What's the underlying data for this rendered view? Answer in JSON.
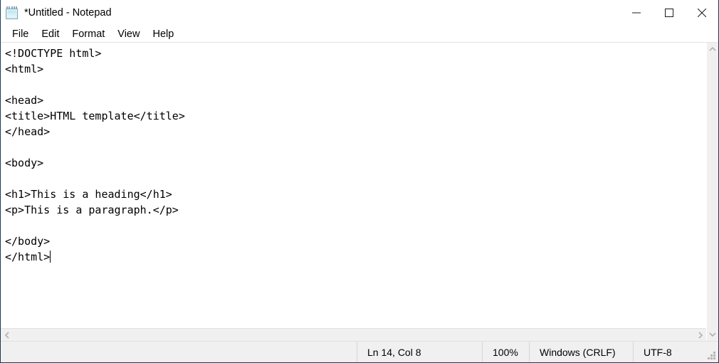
{
  "window": {
    "title": "*Untitled - Notepad",
    "icon": "notepad-icon",
    "border_color": "#1b3a57",
    "controls": [
      {
        "name": "minimize",
        "glyph": "minimize-icon"
      },
      {
        "name": "maximize",
        "glyph": "maximize-icon"
      },
      {
        "name": "close",
        "glyph": "close-icon"
      }
    ]
  },
  "menu": {
    "items": [
      {
        "label": "File"
      },
      {
        "label": "Edit"
      },
      {
        "label": "Format"
      },
      {
        "label": "View"
      },
      {
        "label": "Help"
      }
    ]
  },
  "editor": {
    "lines": [
      "<!DOCTYPE html>",
      "<html>",
      "",
      "<head>",
      "<title>HTML template</title>",
      "</head>",
      "",
      "<body>",
      "",
      "<h1>This is a heading</h1>",
      "<p>This is a paragraph.</p>",
      "",
      "</body>",
      "</html>"
    ],
    "caret_line": 14,
    "caret_col": 8
  },
  "scrollbars": {
    "vertical": {
      "up": "chevron-up-icon",
      "down": "chevron-down-icon"
    },
    "horizontal": {
      "left": "chevron-left-icon",
      "right": "chevron-right-icon"
    }
  },
  "statusbar": {
    "position": "Ln 14, Col 8",
    "zoom": "100%",
    "line_ending": "Windows (CRLF)",
    "encoding": "UTF-8",
    "grip": "resize-grip-icon"
  }
}
